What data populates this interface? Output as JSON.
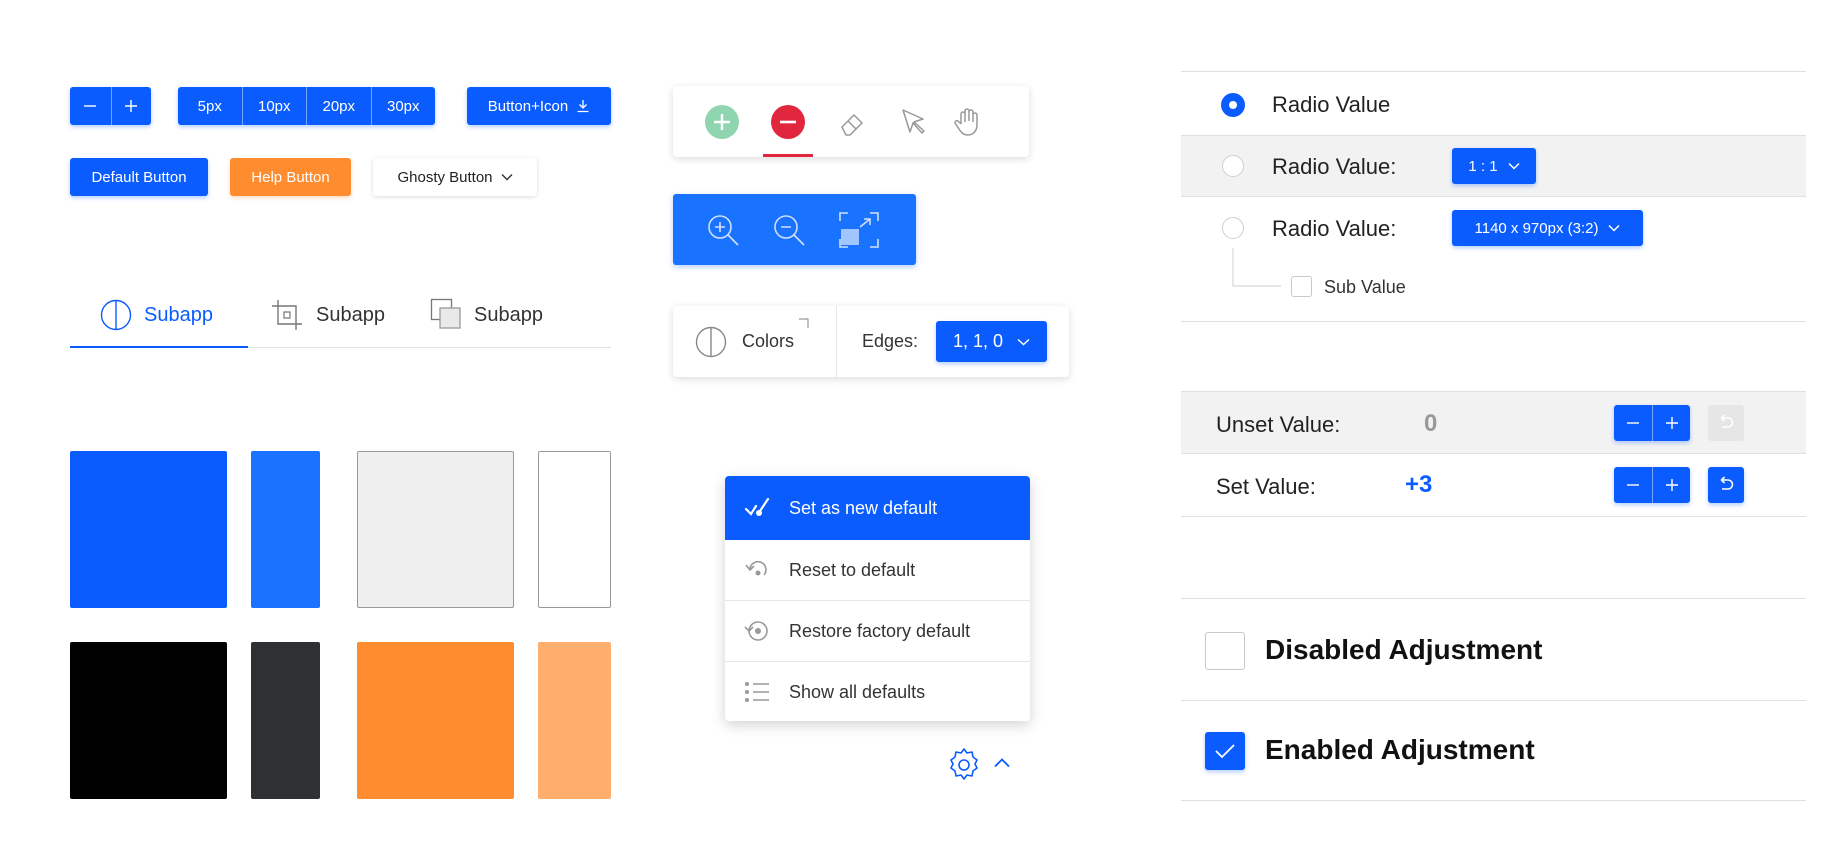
{
  "buttons": {
    "sizes": [
      "5px",
      "10px",
      "20px",
      "30px"
    ],
    "button_icon_label": "Button+Icon",
    "default_label": "Default Button",
    "help_label": "Help Button",
    "ghost_label": "Ghosty Button"
  },
  "tabs": [
    {
      "label": "Subapp",
      "icon": "half-circle-icon",
      "active": true
    },
    {
      "label": "Subapp",
      "icon": "crop-icon",
      "active": false
    },
    {
      "label": "Subapp",
      "icon": "layers-icon",
      "active": false
    }
  ],
  "swatches": [
    {
      "name": "blue",
      "color": "#0a5cff"
    },
    {
      "name": "blue-light",
      "color": "#1a73ff"
    },
    {
      "name": "gray-light",
      "color": "#efefef"
    },
    {
      "name": "white",
      "color": "#ffffff"
    },
    {
      "name": "black",
      "color": "#000000"
    },
    {
      "name": "charcoal",
      "color": "#2e3033"
    },
    {
      "name": "orange",
      "color": "#ff8c2f"
    },
    {
      "name": "orange-light",
      "color": "#ffae6e"
    }
  ],
  "edges_panel": {
    "colors_label": "Colors",
    "edges_label": "Edges:",
    "edges_value": "1, 1, 0"
  },
  "menu": {
    "items": [
      {
        "label": "Set as new default",
        "icon": "brush-check-icon",
        "active": true
      },
      {
        "label": "Reset to default",
        "icon": "undo-icon",
        "active": false
      },
      {
        "label": "Restore factory default",
        "icon": "history-icon",
        "active": false
      },
      {
        "label": "Show all defaults",
        "icon": "list-icon",
        "active": false
      }
    ]
  },
  "radios": {
    "r1_label": "Radio Value",
    "r2_label": "Radio Value:",
    "r2_select": "1 : 1",
    "r3_label": "Radio Value:",
    "r3_select": "1140 x 970px (3:2)",
    "sub_label": "Sub Value"
  },
  "values": {
    "unset_label": "Unset Value:",
    "unset_value": "0",
    "set_label": "Set Value:",
    "set_value": "+3"
  },
  "adjustments": {
    "disabled_label": "Disabled Adjustment",
    "enabled_label": "Enabled Adjustment"
  },
  "colors": {
    "accent": "#0a5cff",
    "orange": "#ff8c2f",
    "danger": "#e0273d",
    "success": "#8fd6b0"
  }
}
